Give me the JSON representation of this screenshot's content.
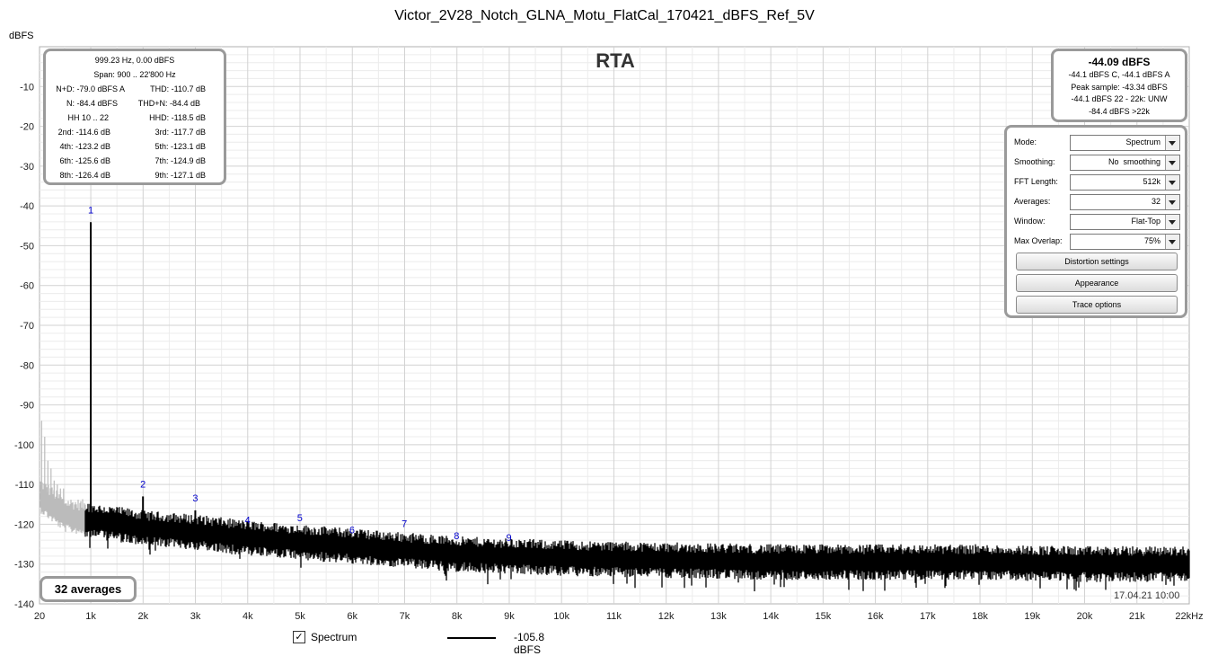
{
  "chart_data": {
    "type": "line",
    "title": "Victor_2V28_Notch_GLNA_Motu_FlatCal_170421_dBFS_Ref_5V",
    "overlay_title": "RTA",
    "ylabel": "dBFS",
    "xlim": [
      20,
      22000
    ],
    "ylim": [
      -140,
      0
    ],
    "y_ticks": [
      -10,
      -20,
      -30,
      -40,
      -50,
      -60,
      -70,
      -80,
      -90,
      -100,
      -110,
      -120,
      -130,
      -140
    ],
    "x_ticks": [
      {
        "v": 20,
        "label": "20"
      },
      {
        "v": 1000,
        "label": "1k"
      },
      {
        "v": 2000,
        "label": "2k"
      },
      {
        "v": 3000,
        "label": "3k"
      },
      {
        "v": 4000,
        "label": "4k"
      },
      {
        "v": 5000,
        "label": "5k"
      },
      {
        "v": 6000,
        "label": "6k"
      },
      {
        "v": 7000,
        "label": "7k"
      },
      {
        "v": 8000,
        "label": "8k"
      },
      {
        "v": 9000,
        "label": "9k"
      },
      {
        "v": 10000,
        "label": "10k"
      },
      {
        "v": 11000,
        "label": "11k"
      },
      {
        "v": 12000,
        "label": "12k"
      },
      {
        "v": 13000,
        "label": "13k"
      },
      {
        "v": 14000,
        "label": "14k"
      },
      {
        "v": 15000,
        "label": "15k"
      },
      {
        "v": 16000,
        "label": "16k"
      },
      {
        "v": 17000,
        "label": "17k"
      },
      {
        "v": 18000,
        "label": "18k"
      },
      {
        "v": 19000,
        "label": "19k"
      },
      {
        "v": 20000,
        "label": "20k"
      },
      {
        "v": 21000,
        "label": "21k"
      },
      {
        "v": 22000,
        "label": "22kHz"
      }
    ],
    "grid": true,
    "series": [
      {
        "name": "Spectrum",
        "color": "#000000",
        "excluded_region_color": "#bbbbbb",
        "noise_floor": {
          "x": [
            20,
            500,
            1000,
            2000,
            3000,
            4000,
            5000,
            6000,
            7000,
            8000,
            10000,
            12000,
            14000,
            16000,
            18000,
            20000,
            22000
          ],
          "y": [
            -113,
            -118,
            -119,
            -121,
            -122,
            -123.5,
            -124.5,
            -125.5,
            -126.5,
            -127.5,
            -128.5,
            -129,
            -129.5,
            -129.5,
            -129.5,
            -130,
            -130
          ]
        },
        "harmonics": [
          {
            "label": "1",
            "x": 999.23,
            "y": -44.09
          },
          {
            "label": "2",
            "x": 1998,
            "y": -113
          },
          {
            "label": "3",
            "x": 2998,
            "y": -116.5
          },
          {
            "label": "4",
            "x": 3997,
            "y": -122
          },
          {
            "label": "5",
            "x": 4996,
            "y": -121.5
          },
          {
            "label": "6",
            "x": 5995,
            "y": -124.5
          },
          {
            "label": "7",
            "x": 6995,
            "y": -123
          },
          {
            "label": "8",
            "x": 7994,
            "y": -126
          },
          {
            "label": "9",
            "x": 8993,
            "y": -126.5
          }
        ]
      }
    ]
  },
  "distortion": {
    "header1": "999.23 Hz, 0.00 dBFS",
    "header2": "Span: 900 .. 22'800 Hz",
    "rows": [
      [
        "N+D: -79.0 dBFS A",
        "THD: -110.7 dB"
      ],
      [
        "N: -84.4 dBFS",
        "THD+N: -84.4 dB"
      ],
      [
        "HH 10 .. 22",
        "HHD: -118.5 dB"
      ],
      [
        "2nd: -114.6 dB",
        "3rd: -117.7 dB"
      ],
      [
        "4th: -123.2 dB",
        "5th: -123.1 dB"
      ],
      [
        "6th: -125.6 dB",
        "7th: -124.9 dB"
      ],
      [
        "8th: -126.4 dB",
        "9th: -127.1 dB"
      ]
    ]
  },
  "level": {
    "main": "-44.09 dBFS",
    "line1": "-44.1 dBFS C, -44.1 dBFS A",
    "line2": "Peak sample: -43.34 dBFS",
    "line3": "-44.1 dBFS 22 - 22k: UNW",
    "line4": "-84.4 dBFS >22k"
  },
  "settings": {
    "mode": {
      "label": "Mode:",
      "value": "Spectrum"
    },
    "smoothing": {
      "label": "Smoothing:",
      "value": "No  smoothing"
    },
    "fft": {
      "label": "FFT Length:",
      "value": "512k"
    },
    "averages": {
      "label": "Averages:",
      "value": "32"
    },
    "window": {
      "label": "Window:",
      "value": "Flat-Top"
    },
    "overlap": {
      "label": "Max Overlap:",
      "value": "75%"
    },
    "distortion_button": "Distortion settings",
    "appearance_button": "Appearance",
    "trace_button": "Trace options"
  },
  "averages_badge": "32 averages",
  "timestamp": "17.04.21 10:00",
  "legend": {
    "checked": "✓",
    "name": "Spectrum",
    "value": "-105.8 dBFS"
  }
}
